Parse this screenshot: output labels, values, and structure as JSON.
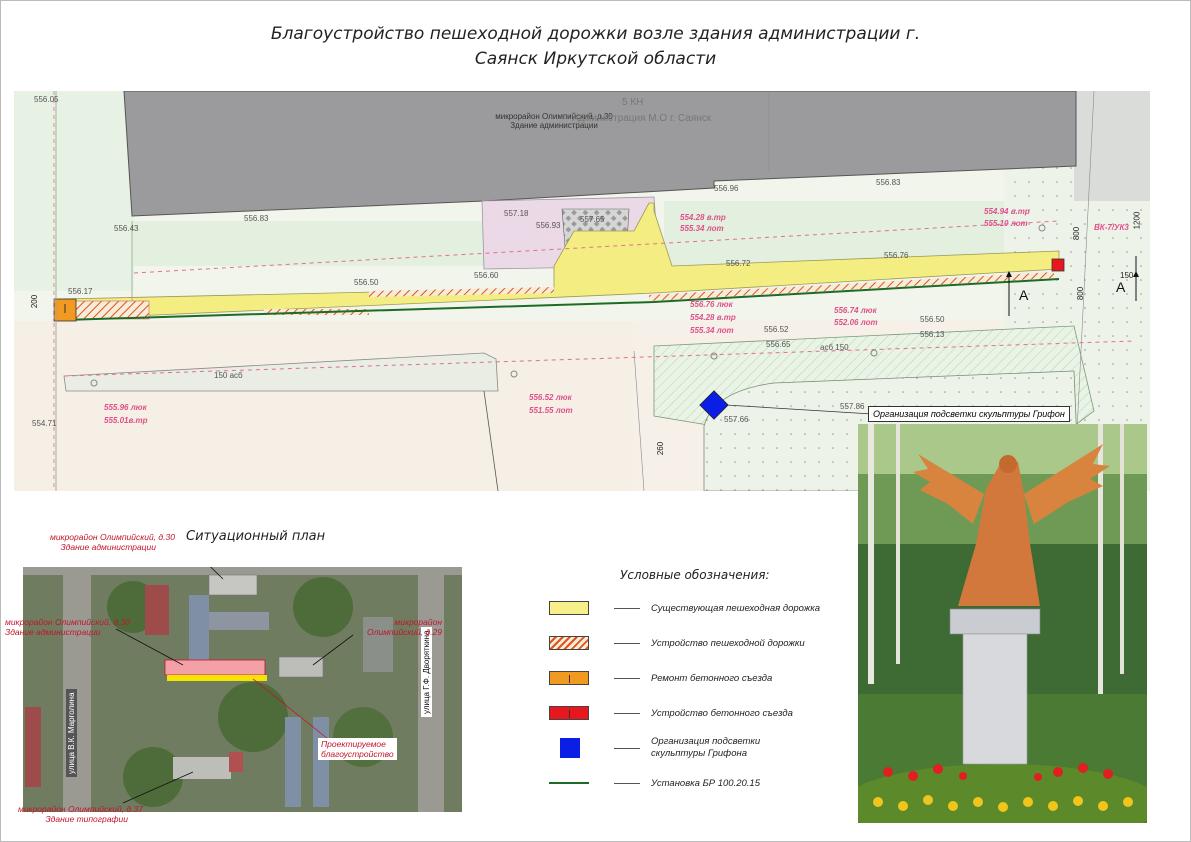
{
  "title": {
    "line1": "Благоустройство пешеходной дорожки возле здания администрации г.",
    "line2": "Саянск Иркутской области"
  },
  "plan": {
    "building_address": "микрорайон Олимпийский, д.30",
    "building_name": "Здание администрации",
    "building_tag": "5 КН",
    "building_org": "Администрация М.О г. Саянск",
    "elevations": [
      "556.05",
      "556.43",
      "556.83",
      "556.60",
      "556.50",
      "557.18",
      "556.93",
      "557.65",
      "556.96",
      "556.83",
      "556.72",
      "556.76",
      "556.17",
      "554.71",
      "556.52",
      "556.65",
      "556.50",
      "556.13",
      "557.86",
      "557.66",
      "556.74",
      "557.74"
    ],
    "pink_marks": [
      {
        "a": "554.28 в.тр",
        "b": "555.34 лот"
      },
      {
        "a": "554.94 в.тр",
        "b": "555.10 лот"
      },
      {
        "a": "556.74 люк",
        "b": "552.06 лот"
      },
      {
        "a": "555.96 люк",
        "b": "555.01в.тр"
      },
      {
        "a": "556.52 люк",
        "b": "551.55 лот"
      },
      {
        "a": "556.76 люк",
        "b": "554.28 в.тр"
      },
      {
        "a": "555.34 лот",
        "b": ""
      }
    ],
    "well": "ВК-7/УК3",
    "asb_label": "асб 150",
    "asb_label2": "150 асб",
    "dims": [
      "200",
      "800",
      "800",
      "1200",
      "150",
      "260"
    ],
    "section_label": "A",
    "callout": "Организация подсветки скульптуры Грифон"
  },
  "situational": {
    "title": "Ситуационный план",
    "labels": [
      {
        "line1": "микрорайон Олимпийский, д.30",
        "line2": "Здание администрации"
      },
      {
        "line1": "микрорайон Олимпийский, д.30",
        "line2": "Здание администрации"
      },
      {
        "line1": "микрорайон",
        "line2": "Олимпийский, д.29"
      },
      {
        "line1": "Проектируемое",
        "line2": "благоустройство"
      },
      {
        "line1": "микрорайон Олимпийский, д.37",
        "line2": "Здание типографии"
      }
    ],
    "street1": "улица В.К. Марголина",
    "street2": "улица Г.Ф. Дворяткина"
  },
  "legend": {
    "title": "Условные обозначения:",
    "items": [
      {
        "label": "Существующая пешеходная дорожка",
        "color": "#f7f08a"
      },
      {
        "label": "Устройство пешеходной дорожки",
        "color": "#f5c892"
      },
      {
        "label": "Ремонт бетонного съезда",
        "color": "#f19a22"
      },
      {
        "label": "Устройство бетонного съезда",
        "color": "#e8171e"
      },
      {
        "label": "Организация подсветки скульптуры Грифона",
        "color": "#0a1ee6"
      },
      {
        "label": "Установка БР 100.20.15",
        "color": "#1d6b26"
      }
    ]
  }
}
